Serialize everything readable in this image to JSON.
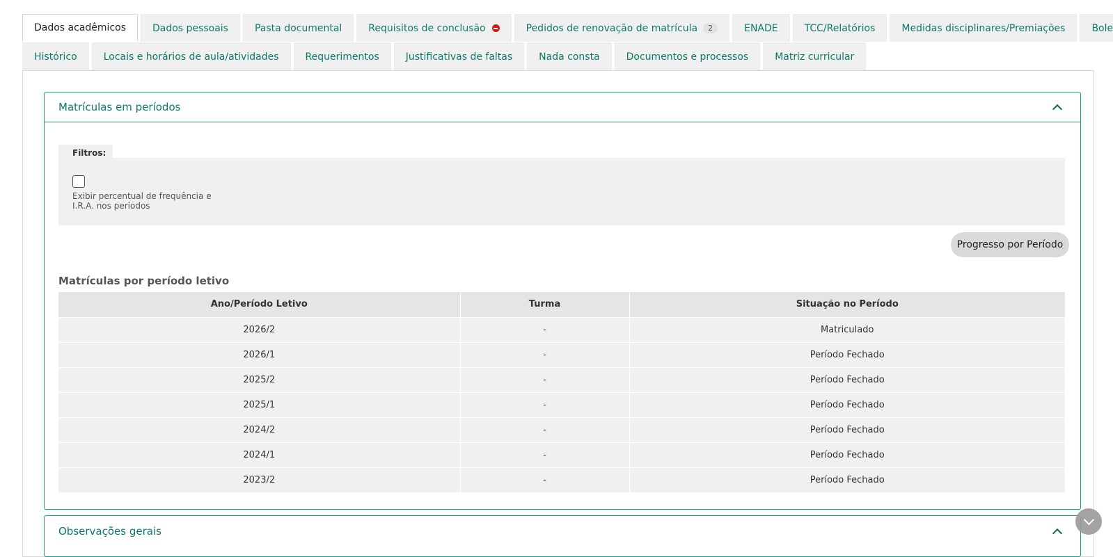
{
  "tabs_row1": [
    {
      "label": "Dados acadêmicos",
      "active": true
    },
    {
      "label": "Dados pessoais"
    },
    {
      "label": "Pasta documental"
    },
    {
      "label": "Requisitos de conclusão",
      "icon": "error-icon"
    },
    {
      "label": "Pedidos de renovação de matrícula",
      "count": "2"
    },
    {
      "label": "ENADE"
    },
    {
      "label": "TCC/Relatórios"
    },
    {
      "label": "Medidas disciplinares/Premiações"
    },
    {
      "label": "Boletins"
    }
  ],
  "tabs_row2": [
    {
      "label": "Histórico"
    },
    {
      "label": "Locais e horários de aula/atividades"
    },
    {
      "label": "Requerimentos"
    },
    {
      "label": "Justificativas de faltas"
    },
    {
      "label": "Nada consta"
    },
    {
      "label": "Documentos e processos"
    },
    {
      "label": "Matriz curricular"
    }
  ],
  "panel": {
    "title": "Matrículas em períodos",
    "filters_label": "Filtros:",
    "checkbox_label": "Exibir percentual de frequência e I.R.A. nos períodos",
    "checkbox_checked": false,
    "progress_button": "Progresso por Período",
    "section_title": "Matrículas por período letivo",
    "table": {
      "headers": [
        "Ano/Período Letivo",
        "Turma",
        "Situação no Período"
      ],
      "rows": [
        [
          "2026/2",
          "-",
          "Matriculado"
        ],
        [
          "2026/1",
          "-",
          "Período Fechado"
        ],
        [
          "2025/2",
          "-",
          "Período Fechado"
        ],
        [
          "2025/1",
          "-",
          "Período Fechado"
        ],
        [
          "2024/2",
          "-",
          "Período Fechado"
        ],
        [
          "2024/1",
          "-",
          "Período Fechado"
        ],
        [
          "2023/2",
          "-",
          "Período Fechado"
        ]
      ]
    }
  },
  "panel2": {
    "title": "Observações gerais"
  },
  "colors": {
    "accent": "#0d7a6a",
    "border": "#19a08c",
    "error": "#cc1b1b"
  }
}
